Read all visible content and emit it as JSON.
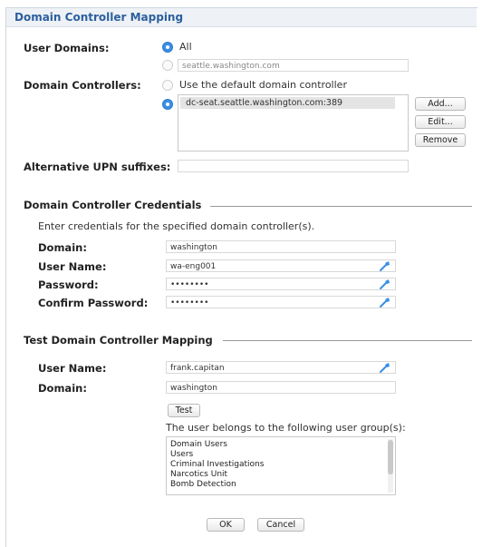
{
  "title": "Domain Controller Mapping",
  "user_domains": {
    "label": "User Domains:",
    "all_option": "All",
    "specific_value": "seattle.washington.com"
  },
  "domain_controllers": {
    "label": "Domain Controllers:",
    "default_option": "Use the default domain controller",
    "selected_entry": "dc-seat.seattle.washington.com:389",
    "add_button": "Add...",
    "edit_button": "Edit...",
    "remove_button": "Remove"
  },
  "upn": {
    "label": "Alternative UPN suffixes:",
    "value": ""
  },
  "credentials": {
    "section_title": "Domain Controller Credentials",
    "instruction": "Enter credentials for the specified domain controller(s).",
    "domain_label": "Domain:",
    "domain_value": "washington",
    "username_label": "User Name:",
    "username_value": "wa-eng001",
    "password_label": "Password:",
    "password_value": "••••••••",
    "confirm_label": "Confirm Password:",
    "confirm_value": "••••••••"
  },
  "test": {
    "section_title": "Test Domain Controller Mapping",
    "username_label": "User Name:",
    "username_value": "frank.capitan",
    "domain_label": "Domain:",
    "domain_value": "washington",
    "test_button": "Test",
    "groups_label": "The user belongs to the following user group(s):",
    "groups": [
      "Domain Users",
      "Users",
      "Criminal Investigations",
      "Narcotics Unit",
      "Bomb Detection"
    ]
  },
  "footer": {
    "ok_button": "OK",
    "cancel_button": "Cancel"
  },
  "colors": {
    "accent": "#3a8ee6",
    "title": "#2c5f9e"
  }
}
